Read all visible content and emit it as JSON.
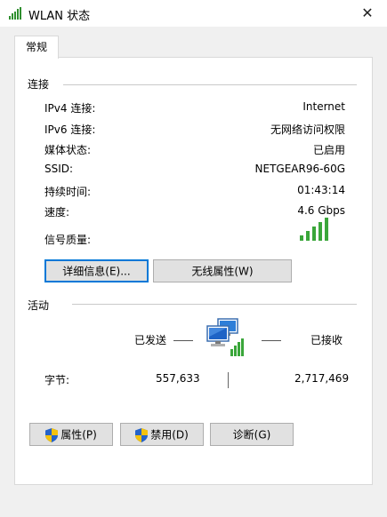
{
  "window": {
    "title": "WLAN 状态",
    "close_glyph": "✕"
  },
  "tabs": [
    {
      "label": "常规"
    }
  ],
  "connection": {
    "group_label": "连接",
    "rows": [
      {
        "label": "IPv4 连接:",
        "value": "Internet"
      },
      {
        "label": "IPv6 连接:",
        "value": "无网络访问权限"
      },
      {
        "label": "媒体状态:",
        "value": "已启用"
      },
      {
        "label": "SSID:",
        "value": "NETGEAR96-60G"
      },
      {
        "label": "持续时间:",
        "value": "01:43:14"
      },
      {
        "label": "速度:",
        "value": "4.6 Gbps"
      },
      {
        "label": "信号质量:",
        "value": ""
      }
    ],
    "signal_icon": "signal-bars-icon",
    "details_button": "详细信息(E)...",
    "wireless_props_button": "无线属性(W)"
  },
  "activity": {
    "group_label": "活动",
    "sent_label": "已发送",
    "received_label": "已接收",
    "bytes_label": "字节:",
    "bytes_sent": "557,633",
    "bytes_received": "2,717,469",
    "network_icon": "network-computers-icon"
  },
  "buttons": {
    "properties": "属性(P)",
    "disable": "禁用(D)",
    "diagnose": "诊断(G)"
  },
  "colors": {
    "accent": "#0078d7",
    "signal": "#3aa63a"
  }
}
